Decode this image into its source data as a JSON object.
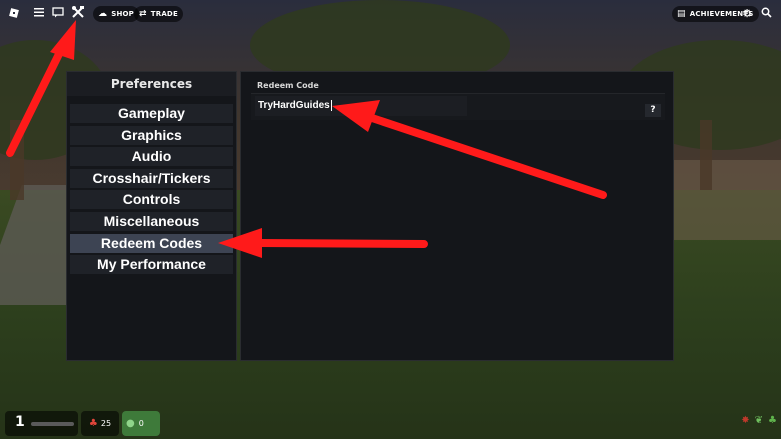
{
  "topbar": {
    "shop_label": "SHOP",
    "trade_label": "TRADE",
    "achievements_label": "ACHIEVEMENTS"
  },
  "preferences": {
    "title": "Preferences",
    "items": [
      {
        "label": "Gameplay"
      },
      {
        "label": "Graphics"
      },
      {
        "label": "Audio"
      },
      {
        "label": "Crosshair/Tickers"
      },
      {
        "label": "Controls"
      },
      {
        "label": "Miscellaneous"
      },
      {
        "label": "Redeem Codes"
      },
      {
        "label": "My Performance"
      }
    ],
    "active_item": "Redeem Codes"
  },
  "redeem": {
    "title": "Redeem Code",
    "input_value": "TryHardGuides",
    "help_label": "?"
  },
  "hud": {
    "level": "1",
    "cash": "25",
    "green_value": "0"
  },
  "icons": [
    "roblox-logo-icon",
    "menu-icon",
    "chat-icon",
    "tools-icon",
    "shop-icon",
    "trade-icon",
    "achievements-icon",
    "gear-icon",
    "search-icon",
    "cash-icon",
    "coin-icon",
    "bug-icon",
    "leaf-icon",
    "clover-icon"
  ],
  "colors": {
    "arrow": "#ff1a1a",
    "active_menu": "#3d4453",
    "panel_bg": "#14161a",
    "green_hud": "#3e7a3a"
  }
}
